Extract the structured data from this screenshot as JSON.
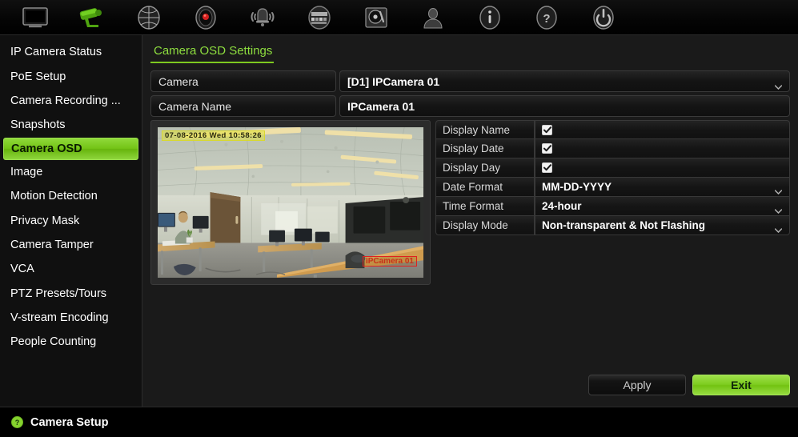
{
  "toolbar": {
    "items": [
      {
        "name": "monitor-icon",
        "label": "Live View"
      },
      {
        "name": "camera-icon",
        "label": "Camera Setup",
        "active": true
      },
      {
        "name": "network-globe-icon",
        "label": "Network Settings"
      },
      {
        "name": "record-icon",
        "label": "Recording"
      },
      {
        "name": "alarm-bell-icon",
        "label": "Alarm"
      },
      {
        "name": "storage-icon",
        "label": "Storage"
      },
      {
        "name": "hdd-icon",
        "label": "HDD"
      },
      {
        "name": "user-icon",
        "label": "User Management"
      },
      {
        "name": "info-icon",
        "label": "System Information"
      },
      {
        "name": "help-icon",
        "label": "Help"
      },
      {
        "name": "power-icon",
        "label": "Shutdown"
      }
    ],
    "active_color": "#5db81f"
  },
  "sidebar": {
    "items": [
      {
        "label": "IP Camera Status",
        "selected": false
      },
      {
        "label": "PoE Setup",
        "selected": false
      },
      {
        "label": "Camera Recording ...",
        "selected": false
      },
      {
        "label": "Snapshots",
        "selected": false
      },
      {
        "label": "Camera OSD",
        "selected": true
      },
      {
        "label": "Image",
        "selected": false
      },
      {
        "label": "Motion Detection",
        "selected": false
      },
      {
        "label": "Privacy Mask",
        "selected": false
      },
      {
        "label": "Camera Tamper",
        "selected": false
      },
      {
        "label": "VCA",
        "selected": false
      },
      {
        "label": "PTZ Presets/Tours",
        "selected": false
      },
      {
        "label": "V-stream Encoding",
        "selected": false
      },
      {
        "label": "People Counting",
        "selected": false
      }
    ],
    "selected_color": "#7ec91f"
  },
  "main": {
    "title": "Camera OSD Settings",
    "title_color": "#8ede3f",
    "camera_row": {
      "label": "Camera",
      "value": "[D1] IPCamera 01"
    },
    "camera_name_row": {
      "label": "Camera Name",
      "value": "IPCamera 01",
      "placeholder": "Camera Name"
    }
  },
  "preview": {
    "osd_timestamp": "07-08-2016 Wed 10:58:26",
    "osd_camera_name": "IPCamera 01",
    "timestamp_color": "#e2e23c",
    "name_box_color": "#e02020"
  },
  "settings": {
    "rows": [
      {
        "label": "Display Name",
        "type": "checkbox",
        "checked": true
      },
      {
        "label": "Display Date",
        "type": "checkbox",
        "checked": true
      },
      {
        "label": "Display Day",
        "type": "checkbox",
        "checked": true
      },
      {
        "label": "Date Format",
        "type": "select",
        "value": "MM-DD-YYYY"
      },
      {
        "label": "Time Format",
        "type": "select",
        "value": "24-hour"
      },
      {
        "label": "Display Mode",
        "type": "select",
        "value": "Non-transparent & Not Flashing"
      }
    ]
  },
  "buttons": {
    "apply": "Apply",
    "exit": "Exit",
    "exit_color": "#7dcc1f"
  },
  "statusbar": {
    "icon": "help-circle-icon",
    "text": "Camera Setup",
    "icon_color": "#86d32e"
  }
}
